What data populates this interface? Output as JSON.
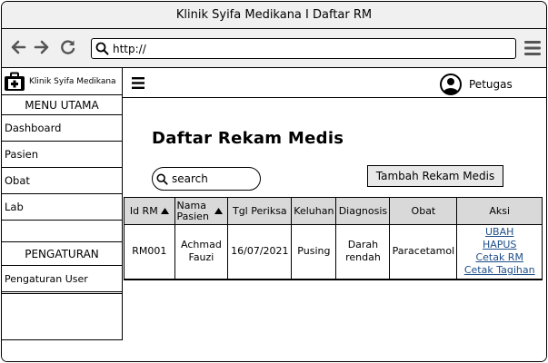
{
  "window": {
    "title": "Klinik Syifa Medikana I Daftar RM"
  },
  "browser": {
    "url": "http://"
  },
  "brand": {
    "name": "Klinik Syifa Medikana"
  },
  "sidebar": {
    "main_heading": "MENU UTAMA",
    "items": [
      {
        "label": "Dashboard"
      },
      {
        "label": "Pasien"
      },
      {
        "label": "Obat"
      },
      {
        "label": "Lab"
      }
    ],
    "settings_heading": "PENGATURAN",
    "settings_items": [
      {
        "label": "Pengaturan User"
      }
    ]
  },
  "topbar": {
    "user_label": "Petugas"
  },
  "main": {
    "title": "Daftar Rekam Medis",
    "search_placeholder": "search",
    "add_button": "Tambah Rekam Medis"
  },
  "table": {
    "headers": {
      "id": "Id RM",
      "nama": "Nama Pasien",
      "tgl": "Tgl Periksa",
      "keluhan": "Keluhan",
      "diagnosis": "Diagnosis",
      "obat": "Obat",
      "aksi": "Aksi"
    },
    "rows": [
      {
        "id": "RM001",
        "nama": "Achmad Fauzi",
        "tgl": "16/07/2021",
        "keluhan": "Pusing",
        "diagnosis": "Darah rendah",
        "obat": "Paracetamol",
        "actions": [
          "UBAH",
          "HAPUS",
          "Cetak RM",
          "Cetak Tagihan"
        ]
      }
    ]
  },
  "colors": {
    "link": "#1d4e89",
    "header_bg": "#d9d9d9",
    "chrome_bg": "#f0f0f0"
  },
  "icons": [
    "back-arrow-icon",
    "forward-arrow-icon",
    "reload-icon",
    "search-icon",
    "browser-menu-icon",
    "medical-kit-icon",
    "hamburger-icon",
    "user-icon",
    "sort-up-icon"
  ]
}
